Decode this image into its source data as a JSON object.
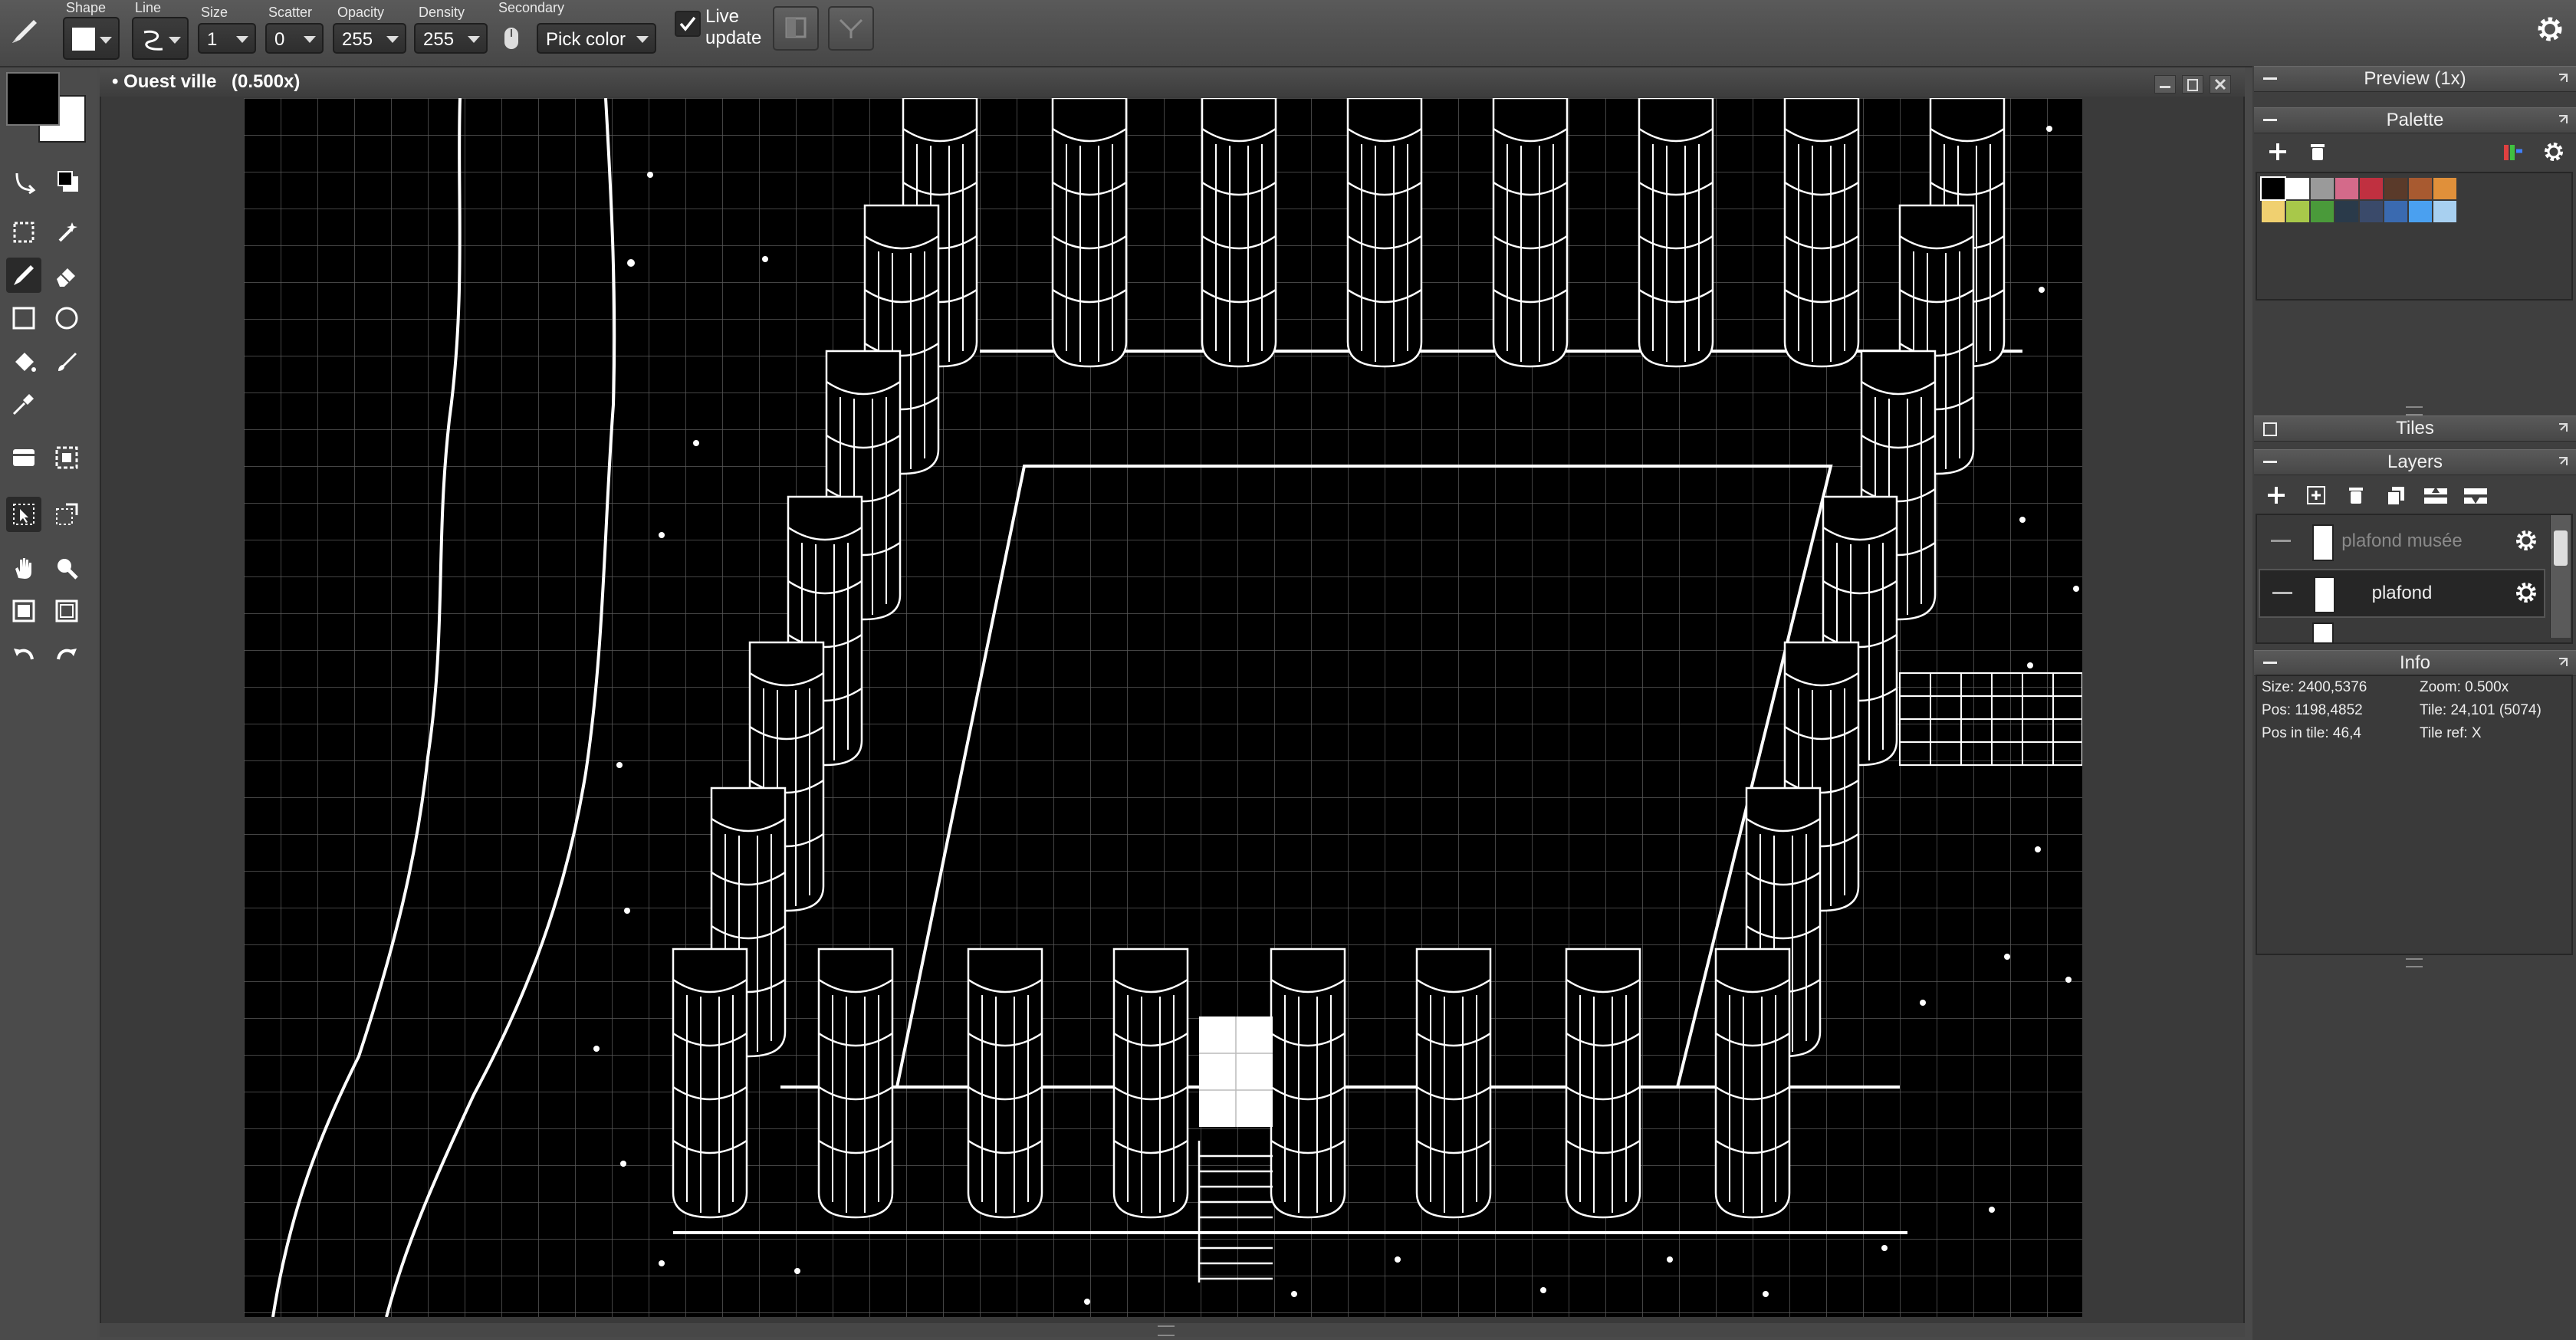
{
  "toolbar": {
    "shape_label": "Shape",
    "line_label": "Line",
    "size_label": "Size",
    "size_value": "1",
    "scatter_label": "Scatter",
    "scatter_value": "0",
    "opacity_label": "Opacity",
    "opacity_value": "255",
    "density_label": "Density",
    "density_value": "255",
    "secondary_label": "Secondary",
    "secondary_value": "Pick color",
    "live_update_line1": "Live",
    "live_update_line2": "update",
    "live_update_checked": true
  },
  "document": {
    "title": "• Ouest ville",
    "zoom": "(0.500x)"
  },
  "colors": {
    "primary": "#000000",
    "secondary": "#ffffff"
  },
  "panels": {
    "preview_title": "Preview (1x)",
    "palette_title": "Palette",
    "tiles_title": "Tiles",
    "layers_title": "Layers",
    "info_title": "Info"
  },
  "palette": {
    "swatches": [
      "#000000",
      "#ffffff",
      "#9a9a9a",
      "#d46a8a",
      "#c03040",
      "#5a3a2a",
      "#a85a30",
      "#e0903a",
      "#f0d070",
      "#a8c84a",
      "#4a9a3a",
      "#2a3a4a",
      "#3a4a6a",
      "#3a6ab0",
      "#4aa0f0",
      "#a8d0f0"
    ]
  },
  "layers": {
    "items": [
      {
        "name": "plafond musée",
        "visible": false,
        "selected": false
      },
      {
        "name": "plafond",
        "visible": true,
        "selected": true
      }
    ]
  },
  "info": {
    "size": "Size: 2400,5376",
    "zoom": "Zoom: 0.500x",
    "pos": "Pos: 1198,4852",
    "tile": "Tile: 24,101 (5074)",
    "pos_in_tile": "Pos in tile: 46,4",
    "tile_ref": "Tile ref: X"
  }
}
